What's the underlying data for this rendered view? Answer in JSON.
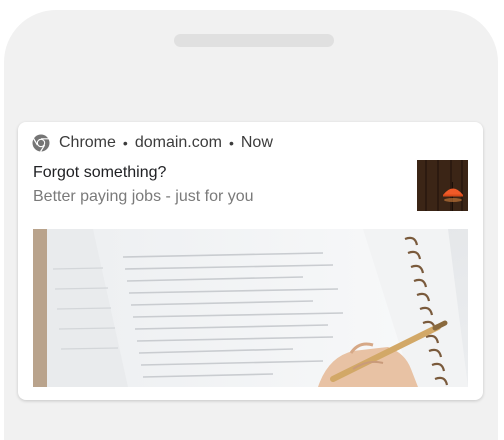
{
  "notification": {
    "app_name": "Chrome",
    "domain": "domain.com",
    "time": "Now",
    "separator": "•",
    "title": "Forgot something?",
    "body": "Better paying jobs - just for you"
  },
  "icons": {
    "app_icon": "chrome-icon",
    "thumbnail": "orange-lamp-image",
    "hero": "notebook-writing-image"
  },
  "colors": {
    "background": "#f1f1f1",
    "card": "#ffffff",
    "title_text": "#202124",
    "body_text": "#7a7a7a"
  }
}
